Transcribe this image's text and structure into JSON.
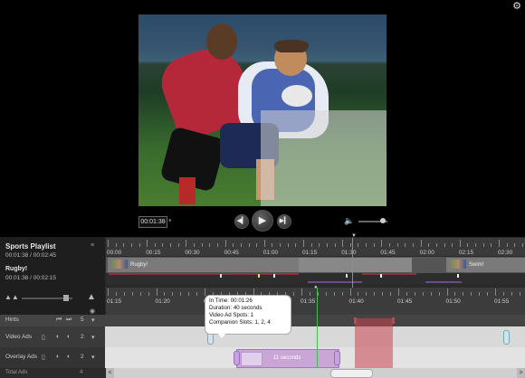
{
  "settings_icon": "gear-icon",
  "player": {
    "current_time": "00:01:38",
    "time_menu_icon": "chevron-down-icon",
    "prev_icon": "skip-back-icon",
    "play_icon": "play-icon",
    "next_icon": "skip-forward-icon",
    "volume_icon": "speaker-icon"
  },
  "playlist": {
    "title": "Sports Playlist",
    "time": "00:01:38 / 00:02:45",
    "menu_icon": "≡",
    "clip_title": "Rugby!",
    "clip_time": "00:01:38 / 00:02:15"
  },
  "top_ruler": {
    "labels": [
      "00:00",
      "00:15",
      "00:30",
      "00:45",
      "01:00",
      "01:15",
      "01:30",
      "01:45",
      "02:00",
      "02:15",
      "02:30"
    ]
  },
  "clips": [
    {
      "label": "Rugby!"
    },
    {
      "label": "Swim!"
    }
  ],
  "detail_ruler": {
    "labels": [
      "01:15",
      "01:20",
      "01:25",
      "01:30",
      "01:35",
      "01:40",
      "01:45",
      "01:50",
      "01:55"
    ]
  },
  "rows": {
    "hints": {
      "label": "Hints",
      "count": "5"
    },
    "video_ads": {
      "label": "Video Ads",
      "count": "2"
    },
    "overlay_ads": {
      "label": "Overlay Ads",
      "count": "2"
    },
    "total_ads": {
      "label": "Total Ads",
      "count": "4"
    }
  },
  "overlay_ad": {
    "label": "11 seconds"
  },
  "tooltip": {
    "in_time": "In Time: 00:01:26",
    "duration": "Duration: 40 seconds",
    "video_ad_spots": "Video Ad Spots: 1",
    "companion_slots": "Companion Slots: 1, 2, 4"
  },
  "scroll": {
    "left": "<",
    "right": ">"
  },
  "colors": {
    "playhead": "#3fbf4f",
    "overlay_ad": "#c9a6d6",
    "ad_zone": "#c84650"
  }
}
